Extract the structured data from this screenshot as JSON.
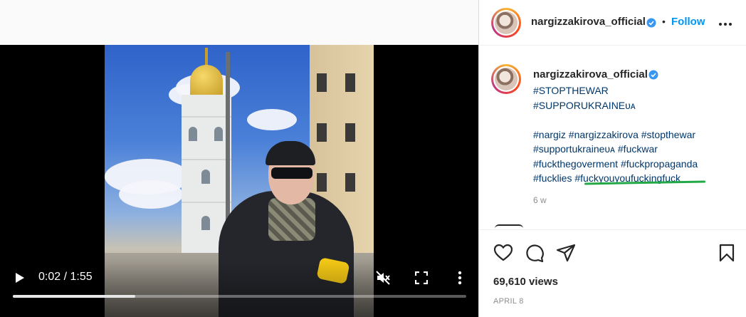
{
  "video": {
    "time_display": "0:02 / 1:55",
    "progress": 0.27
  },
  "post": {
    "username": "nargizzakirova_official",
    "follow_label": "Follow",
    "separator": "•",
    "caption": {
      "username": "nargizzakirova_official",
      "tag1": "#STOPTHEWAR",
      "tag2": "#SUPPORUKRAINEᴜᴀ",
      "line1": "#nargiz #nargizzakirova #stopthewar",
      "line2": "#supportukraineᴜᴀ #fuckwar",
      "line3": "#fuckthegoverment #fuckpropaganda",
      "line4a": "#fucklies",
      "line4b": "#fuckyouyoufuckingfuck"
    },
    "age": "6 w",
    "views": "69,610 views",
    "date": "APRIL 8"
  },
  "colors": {
    "link": "#00376b",
    "follow": "#0095f6",
    "annotation_underline": "#22a844"
  },
  "icons": [
    "play-icon",
    "mute-icon",
    "fullscreen-icon",
    "more-vertical-icon",
    "verified-badge-icon",
    "more-horizontal-icon",
    "heart-icon",
    "comment-icon",
    "share-icon",
    "bookmark-icon"
  ]
}
